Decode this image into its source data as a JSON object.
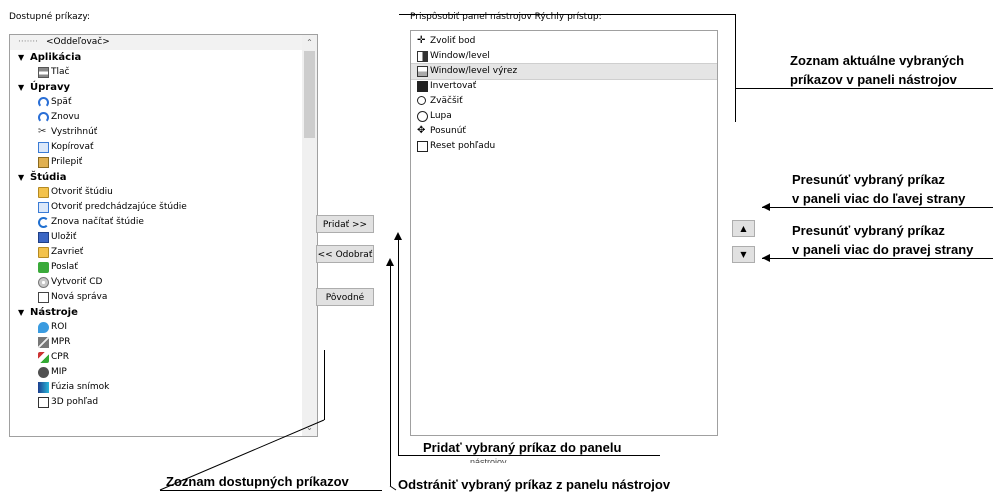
{
  "left_panel": {
    "label": "Dostupné príkazy:",
    "separator": "<Oddeľovač>",
    "groups": [
      {
        "name": "Aplikácia",
        "items": [
          "Tlač"
        ]
      },
      {
        "name": "Úpravy",
        "items": [
          "Späť",
          "Znovu",
          "Vystrihnúť",
          "Kopírovať",
          "Prilepiť"
        ]
      },
      {
        "name": "Štúdia",
        "items": [
          "Otvoriť štúdiu",
          "Otvoriť predchádzajúce štúdie",
          "Znova načítať štúdie",
          "Uložiť",
          "Zavrieť",
          "Poslať",
          "Vytvoriť CD",
          "Nová správa"
        ]
      },
      {
        "name": "Nástroje",
        "items": [
          "ROI",
          "MPR",
          "CPR",
          "MIP",
          "Fúzia snímok",
          "3D pohľad"
        ]
      }
    ]
  },
  "right_panel": {
    "label": "Prispôsobiť panel nástrojov Rýchly prístup:",
    "items": [
      "Zvoliť bod",
      "Window/level",
      "Window/level výrez",
      "Invertovať",
      "Zväčšiť",
      "Lupa",
      "Posunúť",
      "Reset pohľadu"
    ],
    "selected_index": 2
  },
  "buttons": {
    "add": "Pridať >>",
    "remove": "<< Odobrať",
    "default": "Pôvodné"
  },
  "callouts": {
    "current_list_line1": "Zoznam aktuálne vybraných",
    "current_list_line2": "príkazov v paneli nástrojov",
    "move_up_line1": "Presunúť vybraný príkaz",
    "move_up_line2": "v paneli viac do ľavej strany",
    "move_down_line1": "Presunúť vybraný príkaz",
    "move_down_line2": "v paneli viac do pravej strany",
    "add": "Pridať vybraný príkaz do panelu",
    "add_overflow": "nástrojov",
    "available_list": "Zoznam dostupných príkazov",
    "remove": "Odstrániť vybraný príkaz z panelu nástrojov"
  },
  "icons": {
    "left": [
      "printer-icon",
      "undo-icon",
      "redo-icon",
      "cut-icon",
      "copy-icon",
      "paste-icon",
      "open-folder-icon",
      "open-previous-icon",
      "reload-icon",
      "save-icon",
      "close-folder-icon",
      "send-icon",
      "cd-icon",
      "report-icon",
      "roi-icon",
      "mpr-icon",
      "cpr-icon",
      "mip-icon",
      "fusion-icon",
      "3d-view-icon"
    ],
    "right": [
      "crosshair-icon",
      "window-level-icon",
      "window-level-region-icon",
      "invert-icon",
      "zoom-icon",
      "magnifier-icon",
      "pan-icon",
      "reset-view-icon"
    ]
  },
  "colors": {
    "selection": "#e5e5e5",
    "border": "#a0a0a0",
    "button": "#e1e1e1"
  }
}
